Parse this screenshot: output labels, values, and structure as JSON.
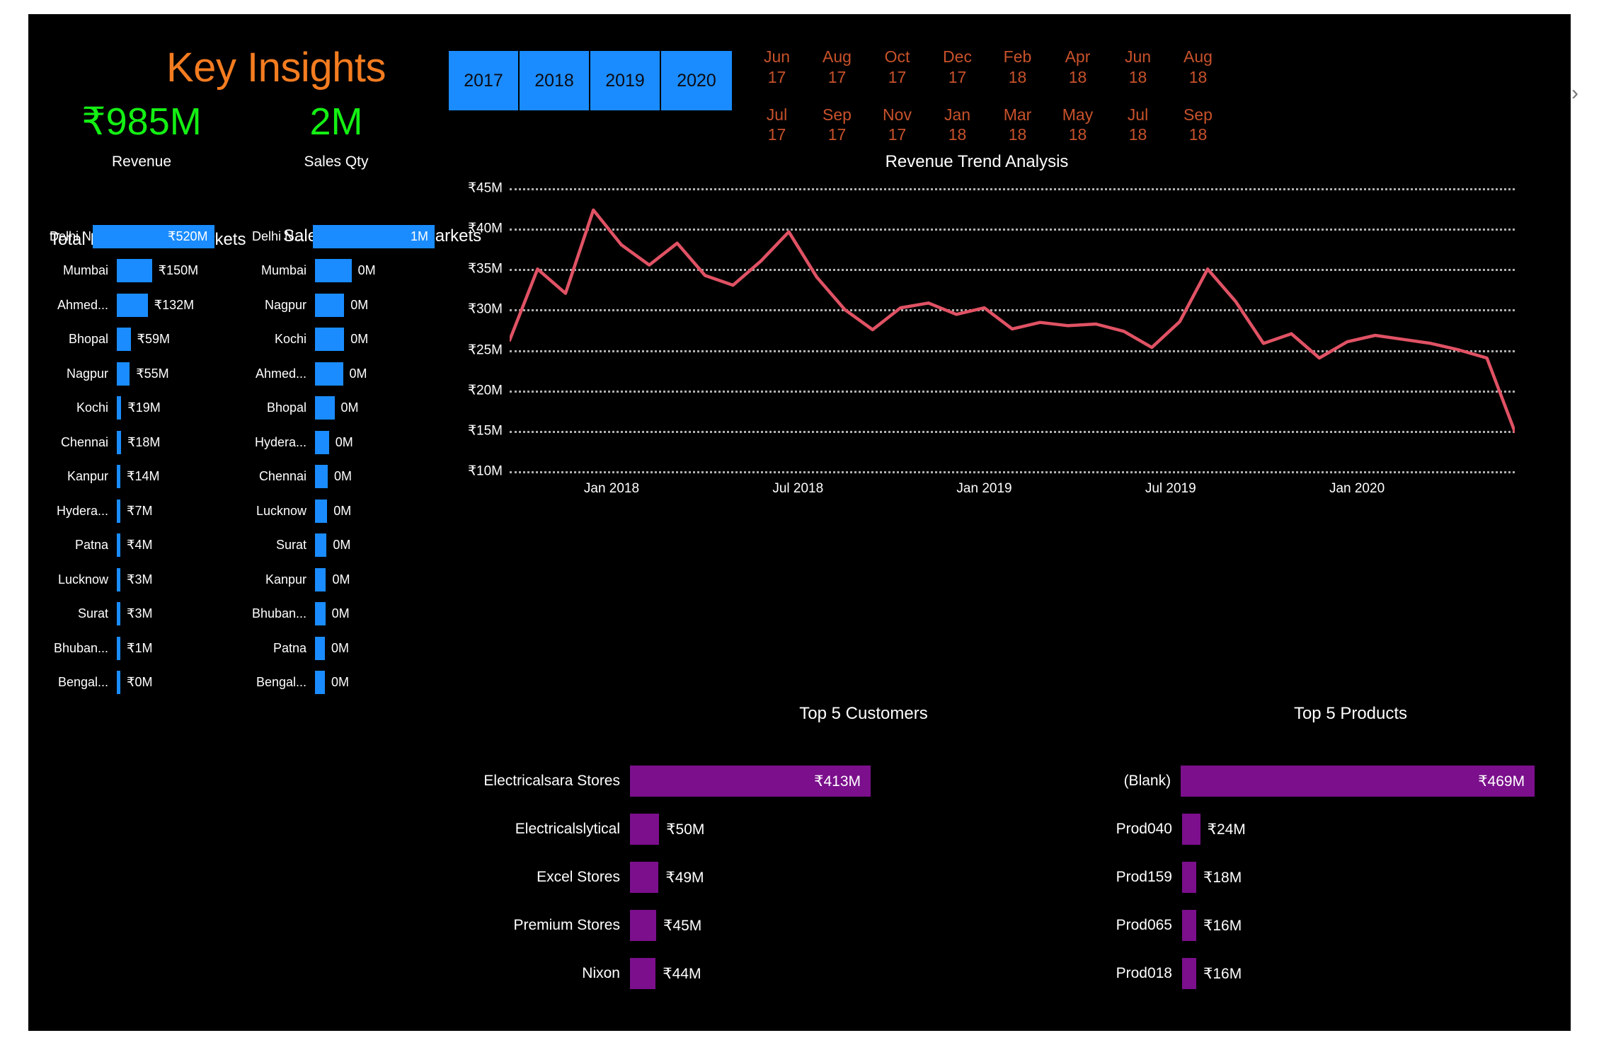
{
  "page": {
    "title": "Key Insights",
    "background": "#000000",
    "accent_orange": "#F47C20",
    "accent_green": "#14F014",
    "accent_blue": "#1A8CFF",
    "accent_purple": "#7B0F8C",
    "accent_line": "#E05264",
    "month_text": "#C8522B"
  },
  "kpis": [
    {
      "value": "₹985M",
      "label": "Revenue"
    },
    {
      "value": "2M",
      "label": "Sales Qty"
    }
  ],
  "year_slicer": {
    "name": "year-slicer",
    "selected_all": true,
    "items": [
      "2017",
      "2018",
      "2019",
      "2020"
    ]
  },
  "month_slicer": {
    "name": "month-slicer",
    "next_arrow": "›",
    "row1": [
      {
        "month": "Jun",
        "year": "17"
      },
      {
        "month": "Aug",
        "year": "17"
      },
      {
        "month": "Oct",
        "year": "17"
      },
      {
        "month": "Dec",
        "year": "17"
      },
      {
        "month": "Feb",
        "year": "18"
      },
      {
        "month": "Apr",
        "year": "18"
      },
      {
        "month": "Jun",
        "year": "18"
      },
      {
        "month": "Aug",
        "year": "18"
      }
    ],
    "row2": [
      {
        "month": "Jul",
        "year": "17"
      },
      {
        "month": "Sep",
        "year": "17"
      },
      {
        "month": "Nov",
        "year": "17"
      },
      {
        "month": "Jan",
        "year": "18"
      },
      {
        "month": "Mar",
        "year": "18"
      },
      {
        "month": "May",
        "year": "18"
      },
      {
        "month": "Jul",
        "year": "18"
      },
      {
        "month": "Sep",
        "year": "18"
      }
    ]
  },
  "chart_data": [
    {
      "name": "total-revenue-by-markets",
      "type": "bar",
      "orientation": "horizontal",
      "title": "Total Revenue by Markets",
      "xlabel": "",
      "ylabel": "",
      "categories": [
        "Delhi N...",
        "Mumbai",
        "Ahmed...",
        "Bhopal",
        "Nagpur",
        "Kochi",
        "Chennai",
        "Kanpur",
        "Hydera...",
        "Patna",
        "Lucknow",
        "Surat",
        "Bhuban...",
        "Bengal..."
      ],
      "values": [
        520,
        150,
        132,
        59,
        55,
        19,
        18,
        14,
        7,
        4,
        3,
        3,
        1,
        0
      ],
      "value_labels": [
        "₹520M",
        "₹150M",
        "₹132M",
        "₹59M",
        "₹55M",
        "₹19M",
        "₹18M",
        "₹14M",
        "₹7M",
        "₹4M",
        "₹3M",
        "₹3M",
        "₹1M",
        "₹0M"
      ],
      "units": "Millions INR",
      "color": "#1A8CFF",
      "max": 520
    },
    {
      "name": "sales-quantity-by-markets",
      "type": "bar",
      "orientation": "horizontal",
      "title": "Sales Quantity by Markets",
      "xlabel": "",
      "ylabel": "",
      "categories": [
        "Delhi N...",
        "Mumbai",
        "Nagpur",
        "Kochi",
        "Ahmed...",
        "Bhopal",
        "Hydera...",
        "Chennai",
        "Lucknow",
        "Surat",
        "Kanpur",
        "Bhuban...",
        "Patna",
        "Bengal..."
      ],
      "values": [
        1.0,
        0.3,
        0.24,
        0.24,
        0.23,
        0.16,
        0.115,
        0.105,
        0.1,
        0.095,
        0.09,
        0.085,
        0.08,
        0.075
      ],
      "value_labels": [
        "1M",
        "0M",
        "0M",
        "0M",
        "0M",
        "0M",
        "0M",
        "0M",
        "0M",
        "0M",
        "0M",
        "0M",
        "0M",
        "0M"
      ],
      "units": "Millions units",
      "color": "#1A8CFF",
      "max": 1.0
    },
    {
      "name": "revenue-trend-analysis",
      "type": "line",
      "title": "Revenue Trend Analysis",
      "xlabel": "",
      "ylabel": "",
      "ylim": [
        10,
        45
      ],
      "yticks": [
        45,
        40,
        35,
        30,
        25,
        20,
        15,
        10
      ],
      "ytick_labels": [
        "₹45M",
        "₹40M",
        "₹35M",
        "₹30M",
        "₹25M",
        "₹20M",
        "₹15M",
        "₹10M"
      ],
      "xticks": [
        "Jan 2018",
        "Jul 2018",
        "Jan 2019",
        "Jul 2019",
        "Jan 2020"
      ],
      "xtick_positions": [
        0.1014,
        0.2868,
        0.4722,
        0.6576,
        0.843
      ],
      "grid": "dotted-horizontal",
      "legend": "none",
      "color": "#E05264",
      "x": [
        "Jun 17",
        "Jul 17",
        "Aug 17",
        "Sep 17",
        "Oct 17",
        "Nov 17",
        "Dec 17",
        "Jan 18",
        "Feb 18",
        "Mar 18",
        "Apr 18",
        "May 18",
        "Jun 18",
        "Jul 18",
        "Aug 18",
        "Sep 18",
        "Oct 18",
        "Nov 18",
        "Dec 18",
        "Jan 19",
        "Feb 19",
        "Mar 19",
        "Apr 19",
        "May 19",
        "Jun 19",
        "Jul 19",
        "Aug 19",
        "Sep 19",
        "Oct 19",
        "Nov 19",
        "Dec 19",
        "Jan 20",
        "Feb 20",
        "Mar 20",
        "Apr 20",
        "May 20",
        "Jun 20"
      ],
      "values": [
        26.2,
        35.0,
        32.0,
        42.3,
        38.0,
        35.5,
        38.2,
        34.2,
        33.0,
        36.0,
        39.6,
        34.0,
        30.0,
        27.5,
        30.2,
        30.8,
        29.4,
        30.2,
        27.6,
        28.4,
        28.0,
        28.2,
        27.3,
        25.3,
        28.5,
        35.0,
        31.0,
        25.8,
        27.0,
        24.0,
        26.0,
        26.8,
        26.3,
        25.8,
        25.0,
        24.0,
        14.9
      ]
    },
    {
      "name": "top-5-customers",
      "type": "bar",
      "orientation": "horizontal",
      "title": "Top 5 Customers",
      "xlabel": "",
      "ylabel": "",
      "categories": [
        "Electricalsara Stores",
        "Electricalslytical",
        "Excel Stores",
        "Premium Stores",
        "Nixon"
      ],
      "values": [
        413,
        50,
        49,
        45,
        44
      ],
      "value_labels": [
        "₹413M",
        "₹50M",
        "₹49M",
        "₹45M",
        "₹44M"
      ],
      "units": "Millions INR",
      "color": "#7B0F8C",
      "max": 413
    },
    {
      "name": "top-5-products",
      "type": "bar",
      "orientation": "horizontal",
      "title": "Top 5 Products",
      "xlabel": "",
      "ylabel": "",
      "categories": [
        "(Blank)",
        "Prod040",
        "Prod159",
        "Prod065",
        "Prod018"
      ],
      "values": [
        469,
        24,
        18,
        16,
        16
      ],
      "value_labels": [
        "₹469M",
        "₹24M",
        "₹18M",
        "₹16M",
        "₹16M"
      ],
      "units": "Millions INR",
      "color": "#7B0F8C",
      "max": 469
    }
  ]
}
